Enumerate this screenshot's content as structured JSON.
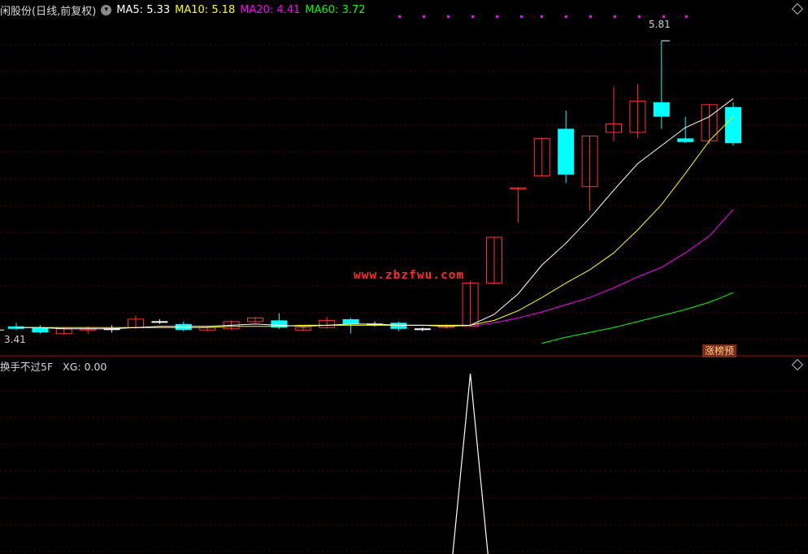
{
  "header": {
    "title": "闲股份(日线,前复权)",
    "ma": [
      {
        "label": "MA5:",
        "value": "5.33",
        "color": "#ffffff"
      },
      {
        "label": "MA10:",
        "value": "5.18",
        "color": "#ffff00"
      },
      {
        "label": "MA20:",
        "value": "4.41",
        "color": "#ff00ff"
      },
      {
        "label": "MA60:",
        "value": "3.72",
        "color": "#00ff00"
      }
    ]
  },
  "subchart": {
    "title": "换手不过5F",
    "xg_label": "XG:",
    "xg_value": "0.00"
  },
  "watermark": "www.zbzfwu.com",
  "badge": "涨榜预",
  "high_label": "5.81",
  "low_label": "3.41",
  "colors": {
    "up": "#ff3232",
    "down": "#00ffff",
    "ma5": "#ffffff",
    "ma10": "#ffff00",
    "ma20": "#ff00ff",
    "ma60": "#00ff00",
    "grid": "#5a0000"
  },
  "chart_data": {
    "type": "candlestick",
    "series": [
      {
        "o": 3.42,
        "c": 3.44,
        "h": 3.47,
        "l": 3.41,
        "dir": "down"
      },
      {
        "o": 3.43,
        "c": 3.39,
        "h": 3.45,
        "l": 3.38,
        "dir": "down"
      },
      {
        "o": 3.38,
        "c": 3.42,
        "h": 3.43,
        "l": 3.37,
        "dir": "up"
      },
      {
        "o": 3.41,
        "c": 3.42,
        "h": 3.44,
        "l": 3.38,
        "dir": "up"
      },
      {
        "o": 3.42,
        "c": 3.42,
        "h": 3.45,
        "l": 3.39,
        "dir": "flat"
      },
      {
        "o": 3.43,
        "c": 3.5,
        "h": 3.53,
        "l": 3.42,
        "dir": "up"
      },
      {
        "o": 3.48,
        "c": 3.48,
        "h": 3.5,
        "l": 3.46,
        "dir": "flat"
      },
      {
        "o": 3.46,
        "c": 3.41,
        "h": 3.48,
        "l": 3.4,
        "dir": "down"
      },
      {
        "o": 3.41,
        "c": 3.43,
        "h": 3.44,
        "l": 3.4,
        "dir": "up"
      },
      {
        "o": 3.42,
        "c": 3.48,
        "h": 3.49,
        "l": 3.41,
        "dir": "up"
      },
      {
        "o": 3.48,
        "c": 3.51,
        "h": 3.52,
        "l": 3.47,
        "dir": "up"
      },
      {
        "o": 3.49,
        "c": 3.43,
        "h": 3.55,
        "l": 3.42,
        "dir": "down"
      },
      {
        "o": 3.41,
        "c": 3.43,
        "h": 3.44,
        "l": 3.4,
        "dir": "up"
      },
      {
        "o": 3.43,
        "c": 3.49,
        "h": 3.52,
        "l": 3.42,
        "dir": "up"
      },
      {
        "o": 3.5,
        "c": 3.46,
        "h": 3.51,
        "l": 3.38,
        "dir": "down"
      },
      {
        "o": 3.46,
        "c": 3.46,
        "h": 3.48,
        "l": 3.44,
        "dir": "flat"
      },
      {
        "o": 3.47,
        "c": 3.42,
        "h": 3.48,
        "l": 3.4,
        "dir": "down"
      },
      {
        "o": 3.42,
        "c": 3.42,
        "h": 3.43,
        "l": 3.4,
        "dir": "flat"
      },
      {
        "o": 3.43,
        "c": 3.44,
        "h": 3.46,
        "l": 3.42,
        "dir": "up"
      },
      {
        "o": 3.44,
        "c": 3.8,
        "h": 3.82,
        "l": 3.44,
        "dir": "up"
      },
      {
        "o": 3.8,
        "c": 4.18,
        "h": 4.18,
        "l": 3.8,
        "dir": "up"
      },
      {
        "o": 4.58,
        "c": 4.59,
        "h": 4.59,
        "l": 4.3,
        "dir": "up"
      },
      {
        "o": 4.69,
        "c": 5.0,
        "h": 5.0,
        "l": 4.69,
        "dir": "up"
      },
      {
        "o": 5.08,
        "c": 4.7,
        "h": 5.23,
        "l": 4.63,
        "dir": "down"
      },
      {
        "o": 4.6,
        "c": 5.02,
        "h": 5.02,
        "l": 4.4,
        "dir": "up"
      },
      {
        "o": 5.05,
        "c": 5.12,
        "h": 5.43,
        "l": 4.98,
        "dir": "up"
      },
      {
        "o": 5.05,
        "c": 5.31,
        "h": 5.45,
        "l": 5.0,
        "dir": "up"
      },
      {
        "o": 5.3,
        "c": 5.18,
        "h": 5.81,
        "l": 5.08,
        "dir": "down"
      },
      {
        "o": 5.0,
        "c": 4.97,
        "h": 5.18,
        "l": 4.96,
        "dir": "down"
      },
      {
        "o": 5.28,
        "c": 4.98,
        "h": 5.28,
        "l": 4.95,
        "dir": "up"
      },
      {
        "o": 5.26,
        "c": 4.96,
        "h": 5.3,
        "l": 4.94,
        "dir": "down"
      }
    ],
    "ma5": [
      3.43,
      3.43,
      3.42,
      3.42,
      3.42,
      3.43,
      3.44,
      3.44,
      3.44,
      3.45,
      3.46,
      3.45,
      3.44,
      3.45,
      3.46,
      3.46,
      3.45,
      3.45,
      3.44,
      3.45,
      3.54,
      3.71,
      3.95,
      4.13,
      4.34,
      4.57,
      4.79,
      4.94,
      5.09,
      5.18,
      5.33
    ],
    "ma10": [
      3.43,
      3.43,
      3.43,
      3.43,
      3.43,
      3.43,
      3.43,
      3.43,
      3.43,
      3.44,
      3.44,
      3.44,
      3.45,
      3.45,
      3.45,
      3.45,
      3.45,
      3.45,
      3.45,
      3.45,
      3.49,
      3.57,
      3.68,
      3.8,
      3.91,
      4.05,
      4.24,
      4.45,
      4.71,
      4.98,
      5.18
    ],
    "ma20": [
      null,
      null,
      null,
      null,
      null,
      null,
      null,
      null,
      null,
      null,
      null,
      null,
      null,
      null,
      null,
      null,
      null,
      null,
      null,
      3.44,
      3.47,
      3.51,
      3.56,
      3.62,
      3.68,
      3.76,
      3.85,
      3.93,
      4.05,
      4.19,
      4.41
    ],
    "ma60": [
      null,
      null,
      null,
      null,
      null,
      null,
      null,
      null,
      null,
      null,
      null,
      null,
      null,
      null,
      null,
      null,
      null,
      null,
      null,
      null,
      null,
      null,
      3.3,
      3.35,
      3.39,
      3.43,
      3.48,
      3.53,
      3.58,
      3.64,
      3.72
    ],
    "xg": [
      0,
      0,
      0,
      0,
      0,
      0,
      0,
      0,
      0,
      0,
      0,
      0,
      0,
      0,
      0,
      0,
      0,
      0,
      0,
      1,
      0,
      0,
      0,
      0,
      0,
      0,
      0,
      0,
      0,
      0,
      0
    ],
    "ylim": [
      3.25,
      6.0
    ]
  }
}
